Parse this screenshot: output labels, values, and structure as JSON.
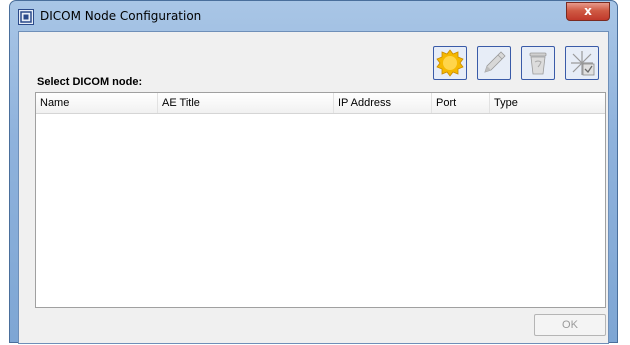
{
  "window": {
    "title": "DICOM Node Configuration",
    "close_label": "x"
  },
  "content": {
    "select_label": "Select DICOM node:"
  },
  "toolbar": {
    "buttons": [
      {
        "name": "add-node-button",
        "icon": "seal-badge-icon"
      },
      {
        "name": "edit-node-button",
        "icon": "pencil-icon"
      },
      {
        "name": "delete-node-button",
        "icon": "trash-bin-icon"
      },
      {
        "name": "verify-node-button",
        "icon": "network-check-icon"
      }
    ]
  },
  "table": {
    "columns": [
      "Name",
      "AE Title",
      "IP Address",
      "Port",
      "Type"
    ],
    "rows": []
  },
  "footer": {
    "ok_label": "OK",
    "ok_enabled": false
  },
  "colors": {
    "frame": "#8fb2dc",
    "close": "#c0392b",
    "toolbar_border": "#3a5ba8",
    "badge": "#f5b800"
  }
}
